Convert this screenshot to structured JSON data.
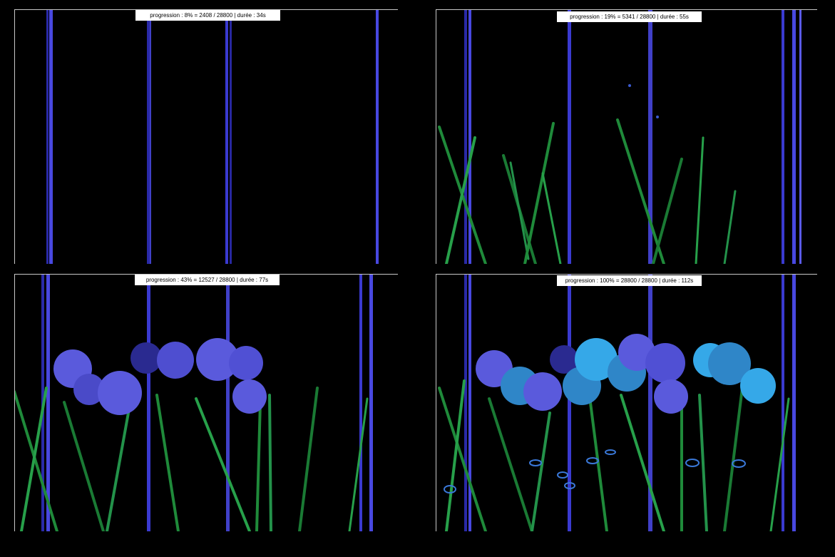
{
  "panels": [
    {
      "label": "progression : 8% = 2408 / 28800 | durée : 34s",
      "colors": {
        "stripe": "#3a3ad0"
      }
    },
    {
      "label": "progression : 19% = 5341 / 28800 | durée : 55s",
      "colors": {
        "stripe": "#3a3ad0",
        "grass": "#1f8a3a"
      }
    },
    {
      "label": "progression : 43% = 12527 / 28800 | durée : 77s",
      "colors": {
        "stripe": "#3a3ad0",
        "grass": "#1f8a3a",
        "flower": "#5a5adc"
      }
    },
    {
      "label": "progression : 100% = 28800 / 28800 | durée : 112s",
      "colors": {
        "stripe": "#3a3ad0",
        "grass": "#1f8a3a",
        "flower": "#5a5adc",
        "flower_alt": "#35a8e8"
      }
    }
  ]
}
